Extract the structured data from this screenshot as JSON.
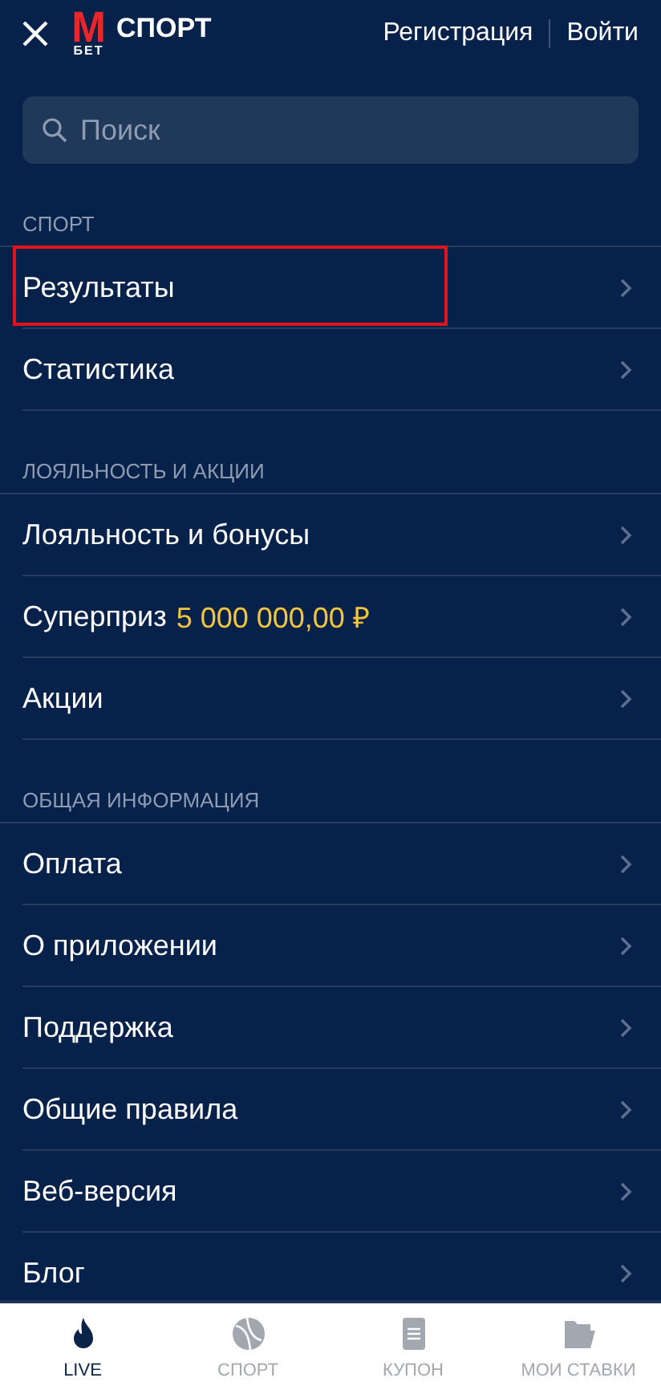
{
  "header": {
    "logo_letter": "М",
    "logo_sub": "БЕТ",
    "logo_word": "СПОРТ",
    "links": [
      "Регистрация",
      "Войти"
    ]
  },
  "search": {
    "placeholder": "Поиск"
  },
  "sections": [
    {
      "title": "СПОРТ",
      "items": [
        {
          "label": "Результаты",
          "highlighted": true
        },
        {
          "label": "Статистика",
          "highlighted": false
        }
      ]
    },
    {
      "title": "ЛОЯЛЬНОСТЬ И АКЦИИ",
      "items": [
        {
          "label": "Лояльность и бонусы",
          "highlighted": false
        },
        {
          "label": "Суперприз",
          "amount": "5 000 000,00 ₽",
          "highlighted": false
        },
        {
          "label": "Акции",
          "highlighted": false
        }
      ]
    },
    {
      "title": "ОБЩАЯ ИНФОРМАЦИЯ",
      "items": [
        {
          "label": "Оплата",
          "highlighted": false
        },
        {
          "label": "О приложении",
          "highlighted": false
        },
        {
          "label": "Поддержка",
          "highlighted": false
        },
        {
          "label": "Общие правила",
          "highlighted": false
        },
        {
          "label": "Веб-версия",
          "highlighted": false
        },
        {
          "label": "Блог",
          "highlighted": false
        }
      ]
    }
  ],
  "bottom_nav": [
    {
      "kind": "live",
      "label": "LIVE",
      "selected": true
    },
    {
      "kind": "sport",
      "label": "СПОРТ",
      "selected": false
    },
    {
      "kind": "coupon",
      "label": "КУПОН",
      "selected": false
    },
    {
      "kind": "bets",
      "label": "МОИ СТАВКИ",
      "selected": false
    }
  ]
}
